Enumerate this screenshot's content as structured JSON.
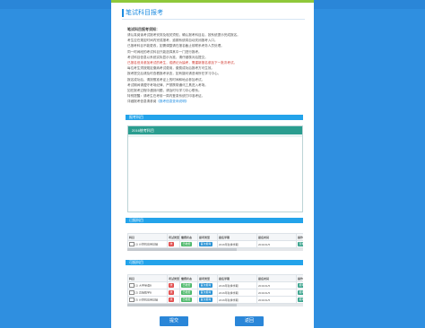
{
  "page": {
    "title": "笔试科目报考"
  },
  "notice": {
    "heading": "笔试科目报考须知：",
    "lines": [
      "请认真阅读考试报考安排及相关须知，确认报考科目后，按系统提示完成报名。",
      "考生应在规定时间内完成报考，逾期系统将自动关闭报考入口。",
      "已报考科目不能更改，如需调整请在报名截止前联系考务人员处理。",
      "同一时间段的考试科目只能选择其中一门进行报考。",
      "考试科目信息以系统实际显示为准，请仔细核对后提交。",
      "已报名但未参加考试的考生，成绩记为缺考，需重新报名参加下一批次考试。",
      "每位考生须按规定缴纳考试费用，缴费成功后报考方可生效。",
      "报考提交后请及时查看报考状态，如有疑问请咨询所在学习中心。",
      "报名成功后，请按照准考证上的时间和地点参加考试。",
      "考试期间请遵守考场纪律，严禁携带通讯工具进入考场。",
      "如在报考过程中遇到问题，请及时与学习中心联系。",
      "特别提醒：请考生在考前一周内登录系统打印准考证。"
    ],
    "link_line_prefix": "详细报考信息请参阅",
    "link_text": "《报考信息查询说明》"
  },
  "sections": {
    "test_header": "报考科目",
    "test_box_header": "2016统考科目",
    "exam_header": "已报科目",
    "available_header": "可报科目"
  },
  "columns": [
    "科目",
    "考试类型",
    "缴费状态",
    "报考类型",
    "报名学期",
    "报名时间",
    "操作"
  ],
  "exam_rows": [
    {
      "course": "(1) 计算机应用基础",
      "type": "统",
      "pay": "已缴费",
      "kind": "首次报考",
      "term": "2016年秋季学期",
      "time": "2016/11/5",
      "action": "查看"
    }
  ],
  "available_rows": [
    {
      "course": "(1) 大学英语B",
      "type": "统",
      "pay": "已缴费",
      "kind": "首次报考",
      "term": "2016年秋季学期",
      "time": "2016/11/5",
      "action": "报考"
    },
    {
      "course": "(2) 高等数学B",
      "type": "统",
      "pay": "已缴费",
      "kind": "首次报考",
      "term": "2016年秋季学期",
      "time": "2016/11/5",
      "action": "报考"
    },
    {
      "course": "(3) 计算机应用基础",
      "type": "统",
      "pay": "已缴费",
      "kind": "首次报考",
      "term": "2016年秋季学期",
      "time": "2016/11/5",
      "action": "报考"
    }
  ],
  "buttons": {
    "submit": "提交",
    "back": "返回"
  },
  "colors": {
    "accent": "#1b8be0",
    "page_bg": "#2f8fe0",
    "teal": "#2a9d8f",
    "badge_red": "#e04a4a",
    "badge_green": "#4cb86a"
  }
}
